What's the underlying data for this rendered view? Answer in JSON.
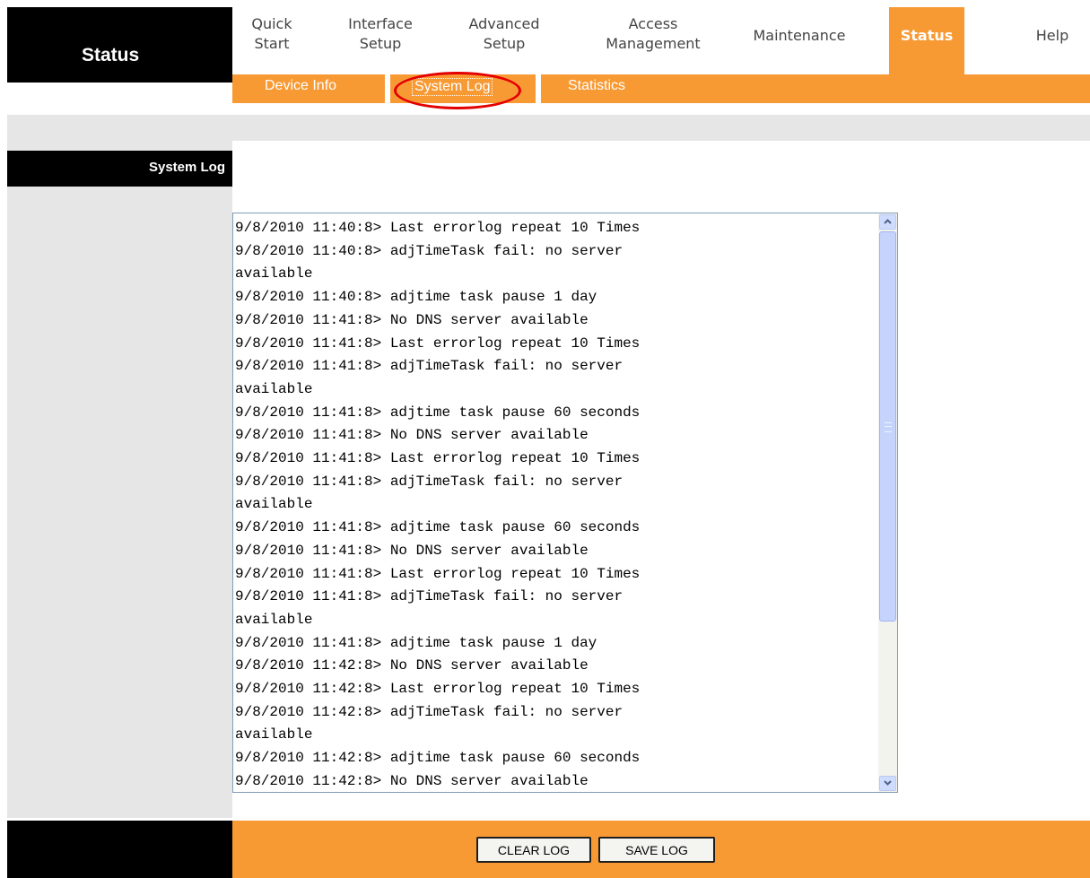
{
  "header": {
    "section_title": "Status",
    "menu": [
      {
        "label": "Quick\nStart"
      },
      {
        "label": "Interface\nSetup"
      },
      {
        "label": "Advanced\nSetup"
      },
      {
        "label": "Access\nManagement"
      },
      {
        "label": "Maintenance"
      },
      {
        "label": "Status",
        "active": true
      },
      {
        "label": "Help"
      }
    ],
    "submenu": [
      {
        "label": "Device Info"
      },
      {
        "label": "System Log",
        "selected": true
      },
      {
        "label": "Statistics"
      }
    ]
  },
  "section": {
    "label": "System Log"
  },
  "log": {
    "text": "9/8/2010 11:40:8> Last errorlog repeat 10 Times\n9/8/2010 11:40:8> adjTimeTask fail: no server\navailable\n9/8/2010 11:40:8> adjtime task pause 1 day\n9/8/2010 11:41:8> No DNS server available\n9/8/2010 11:41:8> Last errorlog repeat 10 Times\n9/8/2010 11:41:8> adjTimeTask fail: no server\navailable\n9/8/2010 11:41:8> adjtime task pause 60 seconds\n9/8/2010 11:41:8> No DNS server available\n9/8/2010 11:41:8> Last errorlog repeat 10 Times\n9/8/2010 11:41:8> adjTimeTask fail: no server\navailable\n9/8/2010 11:41:8> adjtime task pause 60 seconds\n9/8/2010 11:41:8> No DNS server available\n9/8/2010 11:41:8> Last errorlog repeat 10 Times\n9/8/2010 11:41:8> adjTimeTask fail: no server\navailable\n9/8/2010 11:41:8> adjtime task pause 1 day\n9/8/2010 11:42:8> No DNS server available\n9/8/2010 11:42:8> Last errorlog repeat 10 Times\n9/8/2010 11:42:8> adjTimeTask fail: no server\navailable\n9/8/2010 11:42:8> adjtime task pause 60 seconds\n9/8/2010 11:42:8> No DNS server available",
    "scroll_up_icon": "chevron-up-icon",
    "scroll_down_icon": "chevron-down-icon"
  },
  "footer": {
    "clear_label": "CLEAR LOG",
    "save_label": "SAVE LOG"
  },
  "colors": {
    "accent": "#f89a34",
    "header_bg": "#000000",
    "panel_gray": "#e6e6e6",
    "highlight_ring": "#e30000"
  }
}
